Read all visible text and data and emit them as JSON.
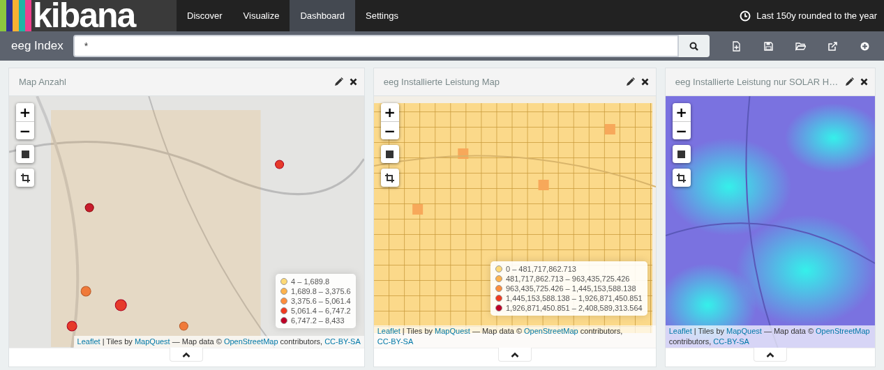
{
  "logo": {
    "text": "kibana"
  },
  "nav": [
    {
      "label": "Discover",
      "selected": false
    },
    {
      "label": "Visualize",
      "selected": false
    },
    {
      "label": "Dashboard",
      "selected": true
    },
    {
      "label": "Settings",
      "selected": false
    }
  ],
  "time_filter": "Last 150y rounded to the year",
  "index_label": "eeg Index",
  "query": {
    "value": "*"
  },
  "panels": [
    {
      "title": "Map Anzahl",
      "zoom_in": "+",
      "zoom_out": "−",
      "legend": [
        {
          "label": "4 – 1,689.8",
          "color": "#fed976"
        },
        {
          "label": "1,689.8 – 3,375.6",
          "color": "#feb24c"
        },
        {
          "label": "3,375.6 – 5,061.4",
          "color": "#fd8d3c"
        },
        {
          "label": "5,061.4 – 6,747.2",
          "color": "#f03b20"
        },
        {
          "label": "6,747.2 – 8,433",
          "color": "#bd0026"
        }
      ],
      "attribution": [
        {
          "text": "Leaflet",
          "kind": "link"
        },
        {
          "text": " | Tiles by ",
          "kind": "text"
        },
        {
          "text": "MapQuest",
          "kind": "link"
        },
        {
          "text": " — Map data © ",
          "kind": "text"
        },
        {
          "text": "OpenStreetMap",
          "kind": "link"
        },
        {
          "text": " contributors, ",
          "kind": "text"
        },
        {
          "text": "CC-BY-SA",
          "kind": "link"
        }
      ]
    },
    {
      "title": "eeg Installierte Leistung Map",
      "zoom_in": "+",
      "zoom_out": "−",
      "legend": [
        {
          "label": "0 – 481,717,862.713",
          "color": "#fed976"
        },
        {
          "label": "481,717,862.713 – 963,435,725.426",
          "color": "#feb24c"
        },
        {
          "label": "963,435,725.426 – 1,445,153,588.138",
          "color": "#fd8d3c"
        },
        {
          "label": "1,445,153,588.138 – 1,926,871,450.851",
          "color": "#f03b20"
        },
        {
          "label": "1,926,871,450.851 – 2,408,589,313.564",
          "color": "#bd0026"
        }
      ],
      "attribution": [
        {
          "text": "Leaflet",
          "kind": "link"
        },
        {
          "text": " | Tiles by ",
          "kind": "text"
        },
        {
          "text": "MapQuest",
          "kind": "link"
        },
        {
          "text": " — Map data © ",
          "kind": "text"
        },
        {
          "text": "OpenStreetMap",
          "kind": "link"
        },
        {
          "text": " contributors, ",
          "kind": "text"
        },
        {
          "text": "CC-BY-SA",
          "kind": "link"
        }
      ]
    },
    {
      "title": "eeg Installierte Leistung nur SOLAR H…",
      "zoom_in": "+",
      "zoom_out": "−",
      "attribution": [
        {
          "text": "Leaflet",
          "kind": "link"
        },
        {
          "text": " | Tiles by ",
          "kind": "text"
        },
        {
          "text": "MapQuest",
          "kind": "link"
        },
        {
          "text": " — Map data © ",
          "kind": "text"
        },
        {
          "text": "OpenStreetMap",
          "kind": "link"
        },
        {
          "text": " contributors, ",
          "kind": "text"
        },
        {
          "text": "CC-BY-SA",
          "kind": "link"
        }
      ]
    }
  ]
}
